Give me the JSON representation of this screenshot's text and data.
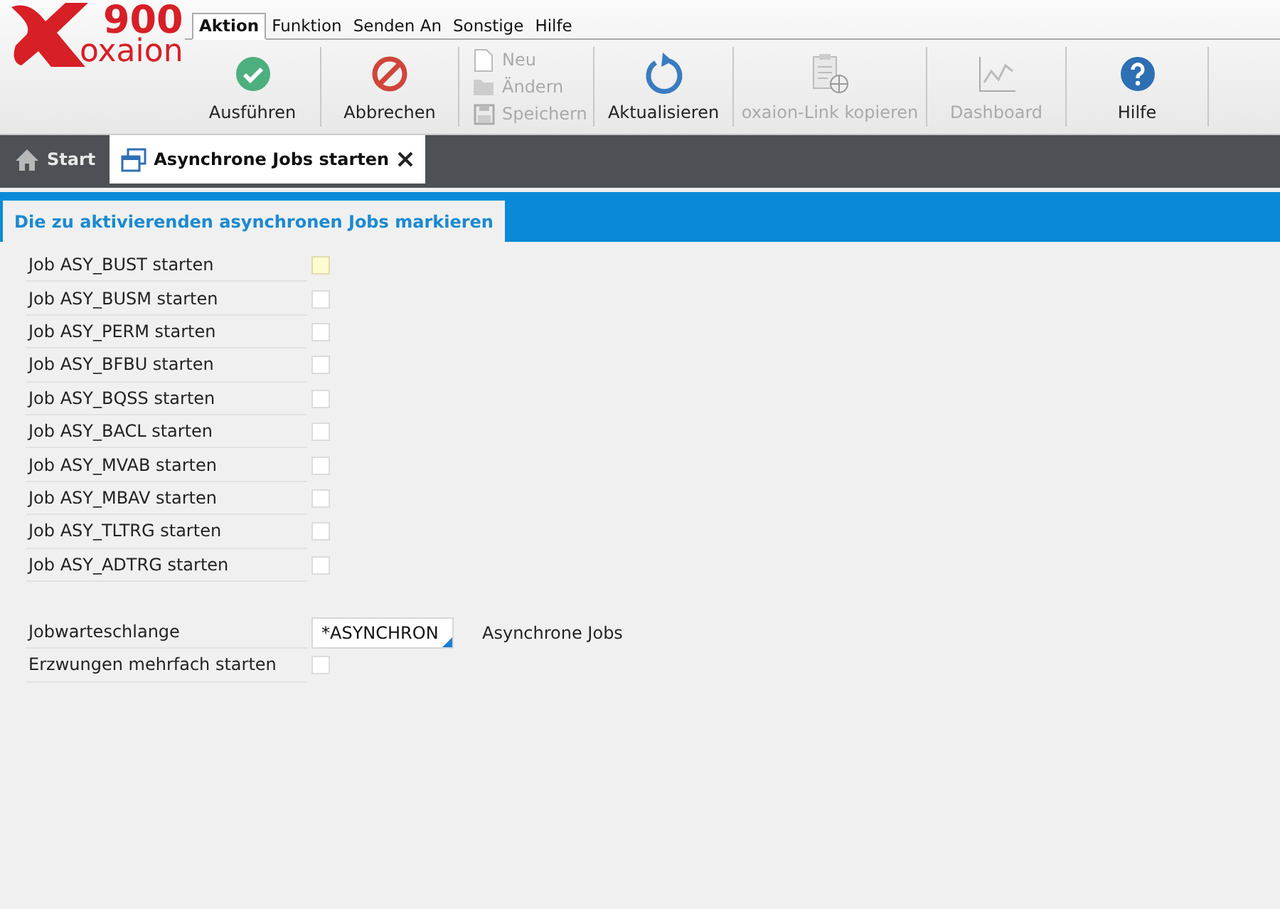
{
  "logo": {
    "number": "900",
    "name": "oxaion"
  },
  "menu_tabs": [
    {
      "label": "Aktion",
      "selected": true
    },
    {
      "label": "Funktion",
      "selected": false
    },
    {
      "label": "Senden An",
      "selected": false
    },
    {
      "label": "Sonstige",
      "selected": false
    },
    {
      "label": "Hilfe",
      "selected": false
    }
  ],
  "toolbar": [
    {
      "kind": "large",
      "label": "Ausführen",
      "disabled": false
    },
    {
      "kind": "large",
      "label": "Abbrechen",
      "disabled": false
    },
    {
      "kind": "stack",
      "items": [
        {
          "label": "Neu",
          "disabled": true
        },
        {
          "label": "Ändern",
          "disabled": true
        },
        {
          "label": "Speichern",
          "disabled": true
        }
      ]
    },
    {
      "kind": "large",
      "label": "Aktualisieren",
      "disabled": false
    },
    {
      "kind": "large",
      "label": "oxaion-Link kopieren",
      "disabled": true
    },
    {
      "kind": "large",
      "label": "Dashboard",
      "disabled": true
    },
    {
      "kind": "large",
      "label": "Hilfe",
      "disabled": false
    }
  ],
  "tabs": [
    {
      "label": "Start",
      "selected": false,
      "closable": false
    },
    {
      "label": "Asynchrone Jobs starten",
      "selected": true,
      "closable": true
    }
  ],
  "section": {
    "title": "Die zu aktivierenden asynchronen Jobs markieren"
  },
  "jobs": [
    {
      "label": "Job ASY_BUST starten",
      "checked": false,
      "focused": true
    },
    {
      "label": "Job ASY_BUSM starten",
      "checked": false,
      "focused": false
    },
    {
      "label": "Job ASY_PERM starten",
      "checked": false,
      "focused": false
    },
    {
      "label": "Job ASY_BFBU starten",
      "checked": false,
      "focused": false
    },
    {
      "label": "Job ASY_BQSS starten",
      "checked": false,
      "focused": false
    },
    {
      "label": "Job ASY_BACL starten",
      "checked": false,
      "focused": false
    },
    {
      "label": "Job ASY_MVAB starten",
      "checked": false,
      "focused": false
    },
    {
      "label": "Job ASY_MBAV starten",
      "checked": false,
      "focused": false
    },
    {
      "label": "Job ASY_TLTRG starten",
      "checked": false,
      "focused": false
    },
    {
      "label": "Job ASY_ADTRG starten",
      "checked": false,
      "focused": false
    }
  ],
  "queue": {
    "label": "Jobwarteschlange",
    "value": "*ASYNCHRON",
    "description": "Asynchrone Jobs"
  },
  "force": {
    "label": "Erzwungen mehrfach starten",
    "checked": false
  }
}
